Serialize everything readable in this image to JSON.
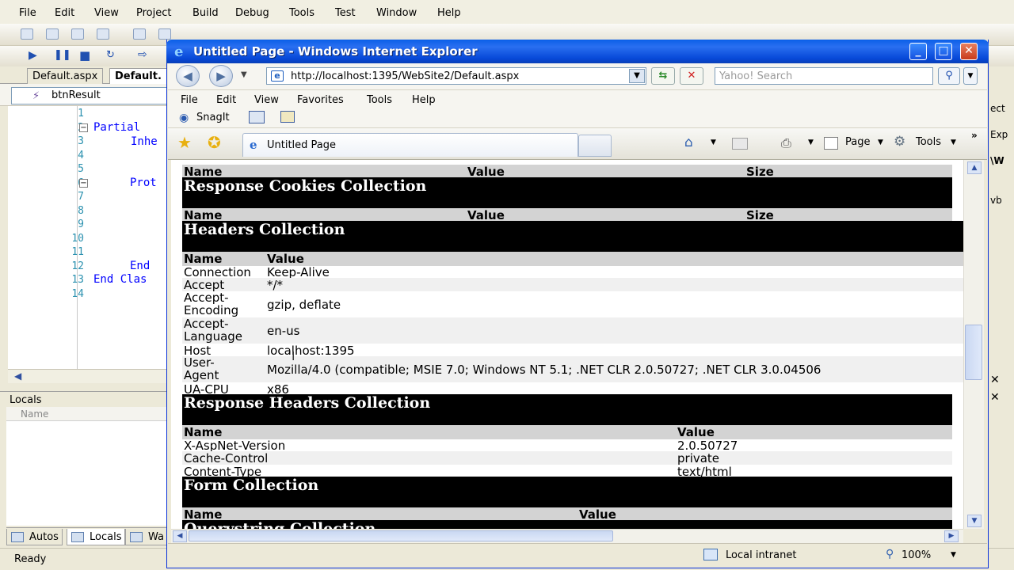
{
  "vs": {
    "menu": [
      "File",
      "Edit",
      "View",
      "Project",
      "Build",
      "Debug",
      "Tools",
      "Test",
      "Window",
      "Help"
    ],
    "doc_tabs": [
      "Default.aspx",
      "Default."
    ],
    "member_combo": "btnResult",
    "line_numbers": [
      "1",
      "2",
      "3",
      "4",
      "5",
      "6",
      "7",
      "8",
      "9",
      "10",
      "11",
      "12",
      "13",
      "14"
    ],
    "code_lines": {
      "l2": "Partial",
      "l3": "Inhe",
      "l6": "Prot",
      "l12": "End",
      "l13": "End Clas"
    },
    "locals_title": "Locals",
    "locals_col_name": "Name",
    "bottom_tabs": [
      "Autos",
      "Locals",
      "Wa"
    ],
    "status": "Ready",
    "right_fragments": [
      "ect",
      "Exp",
      "\\W",
      "vb"
    ]
  },
  "ie": {
    "title": "Untitled Page - Windows Internet Explorer",
    "url": "http://localhost:1395/WebSite2/Default.aspx",
    "search_placeholder": "Yahoo! Search",
    "menu": [
      "File",
      "Edit",
      "View",
      "Favorites",
      "Tools",
      "Help"
    ],
    "snagit": "SnagIt",
    "tab_title": "Untitled Page",
    "cmd_page": "Page",
    "cmd_tools": "Tools",
    "status_zone": "Local intranet",
    "zoom": "100%",
    "winbtns": {
      "min": "_",
      "max": "□",
      "close": "✕"
    }
  },
  "page": {
    "cookies_header": {
      "name": "Name",
      "value": "Value",
      "size": "Size"
    },
    "resp_cookies_title": "Response Cookies Collection",
    "resp_cookies_header": {
      "name": "Name",
      "value": "Value",
      "size": "Size"
    },
    "headers_title": "Headers Collection",
    "headers_header": {
      "name": "Name",
      "value": "Value"
    },
    "headers_rows": [
      {
        "name": "Connection",
        "value": "Keep-Alive"
      },
      {
        "name": "Accept",
        "value": "*/*"
      },
      {
        "name": "Accept-\nEncoding",
        "value": "gzip, deflate"
      },
      {
        "name": "Accept-\nLanguage",
        "value": "en-us"
      },
      {
        "name": "Host",
        "value": "localhost:1395"
      },
      {
        "name": "User-\nAgent",
        "value": "Mozilla/4.0 (compatible; MSIE 7.0; Windows NT 5.1; .NET CLR 2.0.50727; .NET CLR 3.0.04506"
      },
      {
        "name": "UA-CPU",
        "value": "x86"
      }
    ],
    "resp_headers_title": "Response Headers Collection",
    "resp_headers_header": {
      "name": "Name",
      "value": "Value"
    },
    "resp_headers_rows": [
      {
        "name": "X-AspNet-Version",
        "value": "2.0.50727"
      },
      {
        "name": "Cache-Control",
        "value": "private"
      },
      {
        "name": "Content-Type",
        "value": "text/html"
      }
    ],
    "form_title": "Form Collection",
    "form_header": {
      "name": "Name",
      "value": "Value"
    },
    "querystring_title": "Querystring Collection"
  }
}
